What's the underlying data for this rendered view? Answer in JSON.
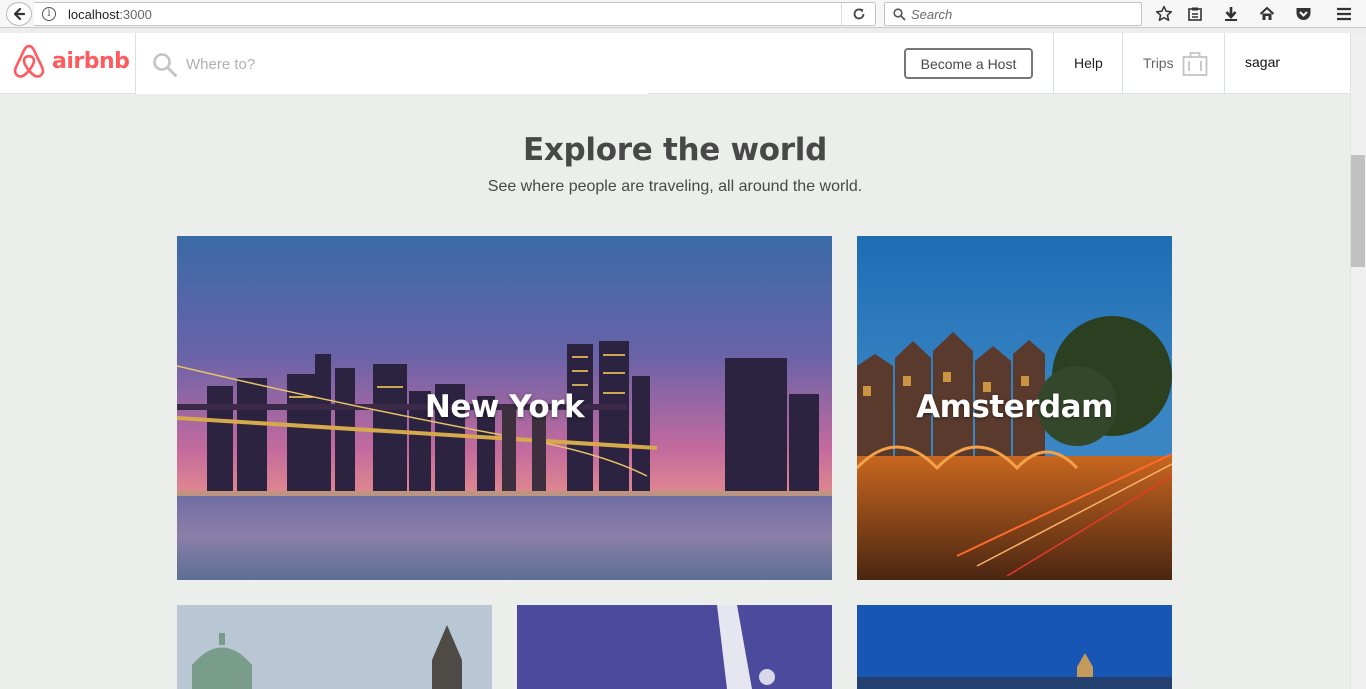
{
  "browser": {
    "url_host": "localhost",
    "url_port": ":3000",
    "search_placeholder": "Search"
  },
  "header": {
    "logo_text": "airbnb",
    "search_placeholder": "Where to?",
    "become_host_label": "Become a Host",
    "help_label": "Help",
    "trips_label": "Trips",
    "user_name": "sagar"
  },
  "main": {
    "title": "Explore the world",
    "subtitle": "See where people are traveling, all around the world.",
    "destinations": [
      {
        "name": "New York"
      },
      {
        "name": "Amsterdam"
      },
      {
        "name": ""
      },
      {
        "name": ""
      },
      {
        "name": ""
      }
    ]
  },
  "colors": {
    "brand": "#ff5a5f",
    "text": "#484848",
    "background": "#eceeec"
  }
}
